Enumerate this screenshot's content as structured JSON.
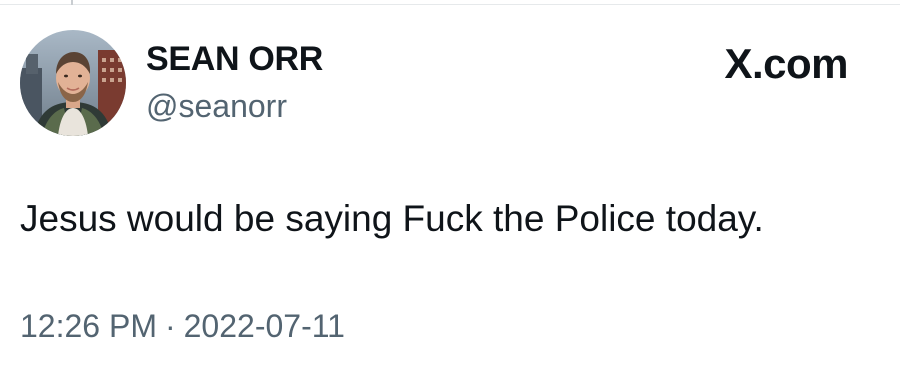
{
  "post": {
    "author": {
      "display_name": "SEAN ORR",
      "handle": "@seanorr",
      "avatar_icon": "profile-photo"
    },
    "brand": "X.com",
    "text": "Jesus would be saying Fuck the Police today.",
    "time": "12:26 PM",
    "separator": "·",
    "date": "2022-07-11"
  },
  "colors": {
    "text_primary": "#0f1419",
    "text_secondary": "#536471",
    "background": "#ffffff"
  }
}
